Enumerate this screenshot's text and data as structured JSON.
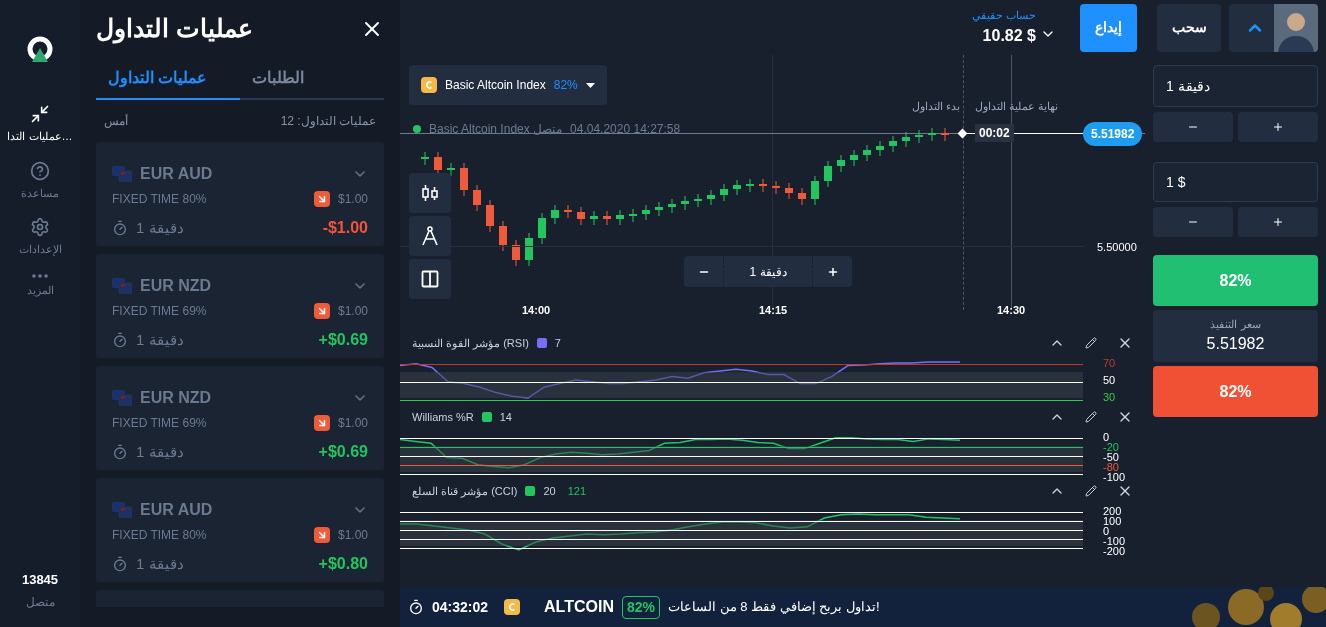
{
  "nav": {
    "items": [
      {
        "label": "عمليات التدا…",
        "selected": true
      },
      {
        "label": "مساعدة",
        "selected": false
      },
      {
        "label": "الإعدادات",
        "selected": false
      },
      {
        "label": "المزيد",
        "selected": false
      }
    ],
    "online_count": "13845",
    "online_label": "متصل"
  },
  "trades_panel": {
    "title": "عمليات التداول",
    "tabs": [
      {
        "label": "الطلبات",
        "selected": false
      },
      {
        "label": "عمليات التداول",
        "selected": true
      }
    ],
    "count_label": "عمليات التداول: 12",
    "date_label": "أمس",
    "trades": [
      {
        "kind": "loss",
        "pair": "EUR AUD",
        "type": "FIXED TIME 80%",
        "amount": "$1.00",
        "duration": "دقيقة 1",
        "result": "-$1.00"
      },
      {
        "kind": "win",
        "pair": "EUR NZD",
        "type": "FIXED TIME 69%",
        "amount": "$1.00",
        "duration": "دقيقة 1",
        "result": "+$0.69"
      },
      {
        "kind": "win",
        "pair": "EUR NZD",
        "type": "FIXED TIME 69%",
        "amount": "$1.00",
        "duration": "دقيقة 1",
        "result": "+$0.69"
      },
      {
        "kind": "win",
        "pair": "EUR AUD",
        "type": "FIXED TIME 80%",
        "amount": "$1.00",
        "duration": "دقيقة 1",
        "result": "+$0.80"
      }
    ]
  },
  "header": {
    "account_label": "حساب حقيقي",
    "balance": "10.82 $",
    "deposit": "إيداع",
    "withdraw": "سحب"
  },
  "chart": {
    "asset": "Basic Altcoin Index",
    "payout": "82%",
    "info_status": "Basic Altcoin Index متصل",
    "info_time": "04.04.2020 14:27:58",
    "start_label": "بدء التداول",
    "end_label": "نهاية عملية التداول",
    "countdown": "00:02",
    "current_price": "5.51982",
    "price_tick": "5.50000",
    "time_ticks": [
      "14:30",
      "14:15",
      "14:00"
    ],
    "duration": "دقيقة 1"
  },
  "indicators": [
    {
      "name": "مؤشر القوة النسبية (RSI)",
      "color": "#7b6cf6",
      "params": [
        "7"
      ],
      "levels": [
        {
          "label": "70",
          "color": "#c0392b"
        },
        {
          "label": "50",
          "color": "#ffffff"
        },
        {
          "label": "30",
          "color": "#2ecc40"
        }
      ]
    },
    {
      "name": "Williams %R",
      "color": "#22c55e",
      "params": [
        "14"
      ],
      "levels": [
        {
          "label": "0",
          "color": "#ffffff"
        },
        {
          "label": "-20",
          "color": "#22c55e"
        },
        {
          "label": "-50",
          "color": "#ffffff"
        },
        {
          "label": "-80",
          "color": "#ef5a3a"
        },
        {
          "label": "-100",
          "color": "#ffffff"
        }
      ]
    },
    {
      "name": "مؤشر قناة السلع (CCI)",
      "color": "#22c55e",
      "params": [
        "121",
        "20"
      ],
      "levels": [
        {
          "label": "200",
          "color": "#ffffff"
        },
        {
          "label": "100",
          "color": "#ffffff"
        },
        {
          "label": "0",
          "color": "#ffffff"
        },
        {
          "label": "-100",
          "color": "#ffffff"
        },
        {
          "label": "-200",
          "color": "#ffffff"
        }
      ]
    }
  ],
  "order_panel": {
    "time_value": "دقيقة 1",
    "amount_value": "1 $",
    "up_payout": "82%",
    "strike_label": "سعر التنفيذ",
    "strike_price": "5.51982",
    "down_payout": "82%"
  },
  "banner": {
    "timer": "04:32:02",
    "asset": "ALTCOIN",
    "payout": "82%",
    "message": "تداول بربح إضافي فقط 8 من الساعات!"
  }
}
